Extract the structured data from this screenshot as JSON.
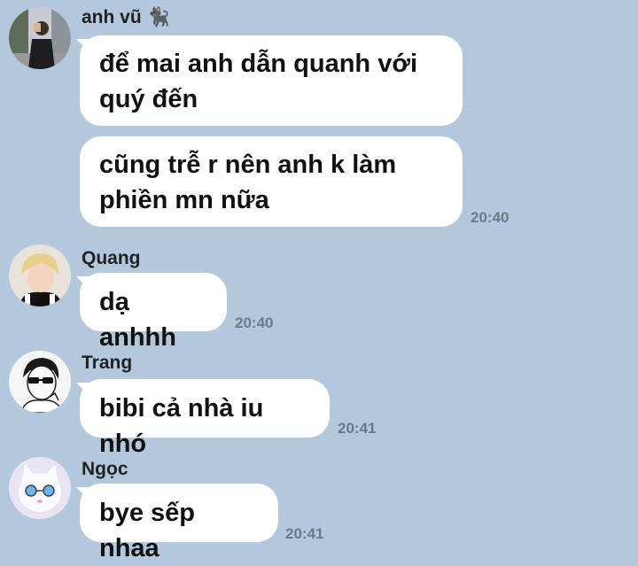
{
  "colors": {
    "background": "#b3c8dc",
    "bubble": "#ffffff",
    "time_text": "#6a7a88"
  },
  "messages": [
    {
      "sender": "anh vũ",
      "sender_emoji": "🐈‍⬛",
      "avatar_icon": "person-photo-avatar",
      "bubbles": [
        {
          "text": "để mai anh dẫn quanh với quý đến"
        },
        {
          "text": "cũng trễ r nên anh k làm phiền mn nữa",
          "time": "20:40"
        }
      ]
    },
    {
      "sender": "Quang",
      "avatar_icon": "blonde-boy-avatar",
      "bubbles": [
        {
          "text": "dạ anhhh",
          "time": "20:40"
        }
      ]
    },
    {
      "sender": "Trang",
      "avatar_icon": "sunglasses-manga-avatar",
      "bubbles": [
        {
          "text": "bibi cả nhà iu nhó",
          "time": "20:41"
        }
      ]
    },
    {
      "sender": "Ngọc",
      "avatar_icon": "cat-sunglasses-avatar",
      "bubbles": [
        {
          "text": "bye sếp nhaa",
          "time": "20:41"
        }
      ]
    }
  ]
}
